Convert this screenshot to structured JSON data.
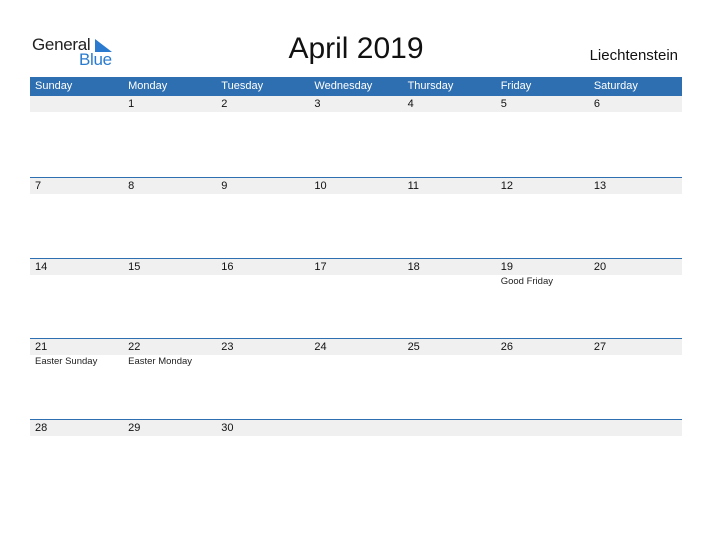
{
  "logo": {
    "line1": "General",
    "line2": "Blue"
  },
  "title": "April 2019",
  "country": "Liechtenstein",
  "colors": {
    "header": "#2e6fb1",
    "band": "#f0f0f0",
    "logo_blue": "#2a7bd0"
  },
  "weekdays": [
    "Sunday",
    "Monday",
    "Tuesday",
    "Wednesday",
    "Thursday",
    "Friday",
    "Saturday"
  ],
  "weeks": [
    [
      {
        "day": "",
        "holiday": ""
      },
      {
        "day": "1",
        "holiday": ""
      },
      {
        "day": "2",
        "holiday": ""
      },
      {
        "day": "3",
        "holiday": ""
      },
      {
        "day": "4",
        "holiday": ""
      },
      {
        "day": "5",
        "holiday": ""
      },
      {
        "day": "6",
        "holiday": ""
      }
    ],
    [
      {
        "day": "7",
        "holiday": ""
      },
      {
        "day": "8",
        "holiday": ""
      },
      {
        "day": "9",
        "holiday": ""
      },
      {
        "day": "10",
        "holiday": ""
      },
      {
        "day": "11",
        "holiday": ""
      },
      {
        "day": "12",
        "holiday": ""
      },
      {
        "day": "13",
        "holiday": ""
      }
    ],
    [
      {
        "day": "14",
        "holiday": ""
      },
      {
        "day": "15",
        "holiday": ""
      },
      {
        "day": "16",
        "holiday": ""
      },
      {
        "day": "17",
        "holiday": ""
      },
      {
        "day": "18",
        "holiday": ""
      },
      {
        "day": "19",
        "holiday": "Good Friday"
      },
      {
        "day": "20",
        "holiday": ""
      }
    ],
    [
      {
        "day": "21",
        "holiday": "Easter Sunday"
      },
      {
        "day": "22",
        "holiday": "Easter Monday"
      },
      {
        "day": "23",
        "holiday": ""
      },
      {
        "day": "24",
        "holiday": ""
      },
      {
        "day": "25",
        "holiday": ""
      },
      {
        "day": "26",
        "holiday": ""
      },
      {
        "day": "27",
        "holiday": ""
      }
    ],
    [
      {
        "day": "28",
        "holiday": ""
      },
      {
        "day": "29",
        "holiday": ""
      },
      {
        "day": "30",
        "holiday": ""
      },
      {
        "day": "",
        "holiday": ""
      },
      {
        "day": "",
        "holiday": ""
      },
      {
        "day": "",
        "holiday": ""
      },
      {
        "day": "",
        "holiday": ""
      }
    ]
  ]
}
